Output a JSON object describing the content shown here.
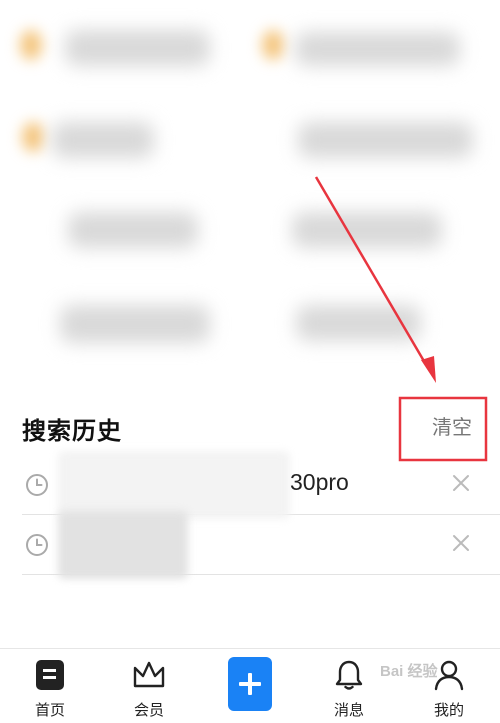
{
  "history": {
    "title": "搜索历史",
    "clear_label": "清空",
    "items": [
      {
        "query": "30pro"
      },
      {
        "query": ""
      }
    ]
  },
  "tabbar": {
    "items": [
      {
        "label": "首页",
        "icon": "home-doc-icon"
      },
      {
        "label": "会员",
        "icon": "crown-icon"
      },
      {
        "label": "",
        "icon": "plus-icon"
      },
      {
        "label": "消息",
        "icon": "bell-icon"
      },
      {
        "label": "我的",
        "icon": "user-icon"
      }
    ]
  },
  "watermark": {
    "text": "Bai 经验"
  },
  "colors": {
    "accent": "#1a82f5",
    "annotation": "#e8353f"
  }
}
